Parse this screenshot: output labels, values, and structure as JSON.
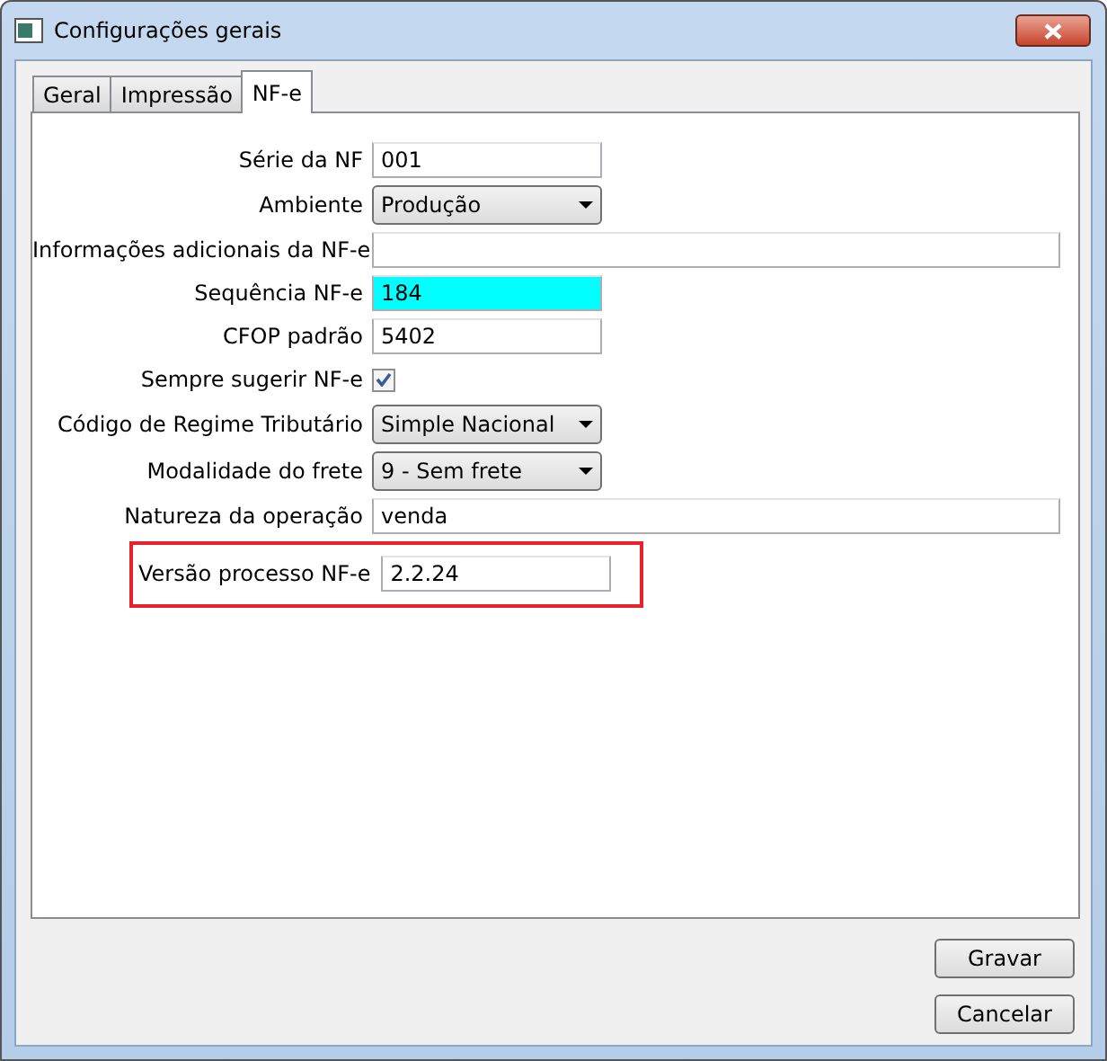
{
  "window": {
    "title": "Configurações gerais"
  },
  "tabs": [
    {
      "label": "Geral",
      "selected": false
    },
    {
      "label": "Impressão",
      "selected": false
    },
    {
      "label": "NF-e",
      "selected": true
    }
  ],
  "fields": [
    {
      "label": "Série da NF",
      "kind": "text",
      "value": "001"
    },
    {
      "label": "Ambiente",
      "kind": "select",
      "value": "Produção"
    },
    {
      "label": "Informações adicionais da NF-e",
      "kind": "widetext"
    },
    {
      "label": "Sequência NF-e",
      "kind": "text",
      "value": "184",
      "color": "#00ffff"
    },
    {
      "label": "CFOP padrão",
      "kind": "text",
      "value": "5402"
    },
    {
      "label": "Sempre sugerir NF-e",
      "kind": "checkbox",
      "checked": true
    },
    {
      "label": "Código de Regime Tributário",
      "kind": "select",
      "value": "Simple Nacional"
    },
    {
      "label": "Modalidade do frete",
      "kind": "select",
      "value": "9 - Sem frete"
    },
    {
      "label": "Natureza da operação",
      "kind": "widetext",
      "value": "venda"
    },
    {
      "label": "Versão processo NF-e",
      "kind": "text",
      "value": "2.2.24",
      "highlighted": true
    }
  ],
  "buttons": [
    "Gravar",
    "Cancelar"
  ]
}
